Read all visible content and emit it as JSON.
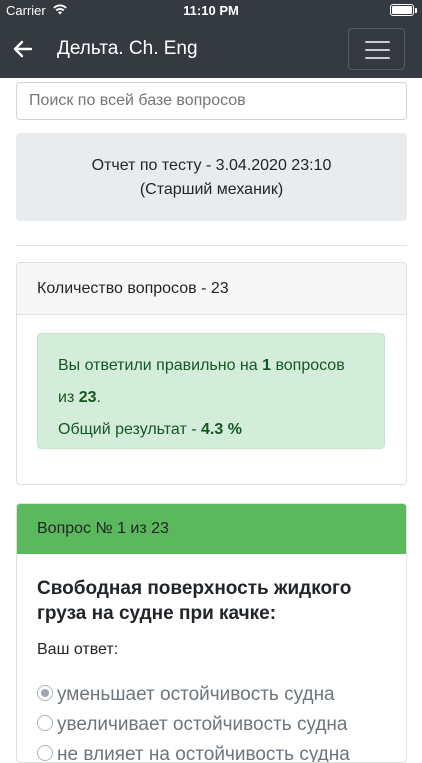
{
  "status_bar": {
    "carrier": "Carrier",
    "time": "11:10 PM"
  },
  "navbar": {
    "title": "Дельта. Ch. Eng",
    "back_icon": "arrow-left-icon",
    "menu_icon": "hamburger-menu-icon"
  },
  "search": {
    "placeholder": "Поиск по всей базе вопросов"
  },
  "report": {
    "line1": "Отчет по тесту - 3.04.2020 23:10",
    "line2": "(Старший механик)"
  },
  "summary_card": {
    "header": "Количество вопросов - 23",
    "alert": {
      "text_before": "Вы ответили правильно на ",
      "correct": "1",
      "text_mid": " вопросов из ",
      "total": "23",
      "text_end": ".",
      "result_label": "Общий результат - ",
      "result_value": "4.3 %"
    }
  },
  "question_card": {
    "header": "Вопрос № 1 из 23",
    "question": "Свободная поверхность жидкого груза на судне при качке:",
    "answer_label": "Ваш ответ:",
    "options": [
      {
        "text": "уменьшает остойчивость судна",
        "checked": true
      },
      {
        "text": "увеличивает остойчивость судна",
        "checked": false
      },
      {
        "text": "не влияет на остойчивость судна",
        "checked": false
      }
    ]
  },
  "colors": {
    "navbar": "#343a40",
    "success_header": "#5cb85c",
    "alert_bg": "#d4edda",
    "alert_text": "#155724",
    "report_bg": "#e9ecef"
  }
}
